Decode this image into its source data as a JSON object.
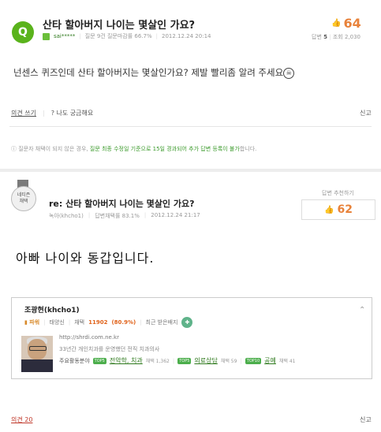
{
  "question": {
    "badge": "Q",
    "title": "산타 할아버지 나이는 몇살인 가요?",
    "username": "sai*****",
    "stats_text": "질문 9건 질문마감률 66.7%",
    "date": "2012.12.24 20:14",
    "vote_count": "64",
    "answers_label": "답변",
    "answers_count": "5",
    "views_label": "조회",
    "views_count": "2,030",
    "body": "넌센스 퀴즈인데 산타 할아버지는 몇살인가요? 제발 빨리좀 알려 주세요",
    "opinion_link": "의견 쓰기",
    "curious_label": "나도 궁금해요",
    "report_label": "신고",
    "notice_prefix": "질문자 채택이 되지 않은 경우,",
    "notice_highlight": "질문 최종 수정일 기준으로 15일 경과되어 추가 답변 등록이 불가",
    "notice_suffix": "합니다."
  },
  "answer": {
    "medal_text_1": "네티즌",
    "medal_text_2": "채택",
    "title": "re: 산타 할아버지 나이는 몇살인 가요?",
    "author": "녹아(khcho1)",
    "adopt_rate": "답변채택률 83.1%",
    "date": "2012.12.24 21:17",
    "vote_label": "답변 추천하기",
    "vote_count": "62",
    "body": "아빠 나이와 동갑입니다.",
    "opinion_link": "의견 20",
    "report_label": "신고"
  },
  "profile": {
    "name": "조광현(khcho1)",
    "power_label": "파워",
    "grade": "태양신",
    "adopt_label": "채택",
    "adopt_count": "11902",
    "adopt_percent": "(80.9%)",
    "badge_label": "최근 받은배지",
    "url": "http://shrdi.com.ne.kr",
    "career": "33년간 개인치과를 운영했던 전직 치과의사",
    "fields_label": "주요활동분야",
    "fields": [
      {
        "tag": "TOP5",
        "name": "전악학, 치과",
        "count": "채택 1,362"
      },
      {
        "tag": "TOP5",
        "name": "의료상담",
        "count": "채택 59"
      },
      {
        "tag": "TOP10",
        "name": "공예",
        "count": "채택 41"
      }
    ]
  }
}
